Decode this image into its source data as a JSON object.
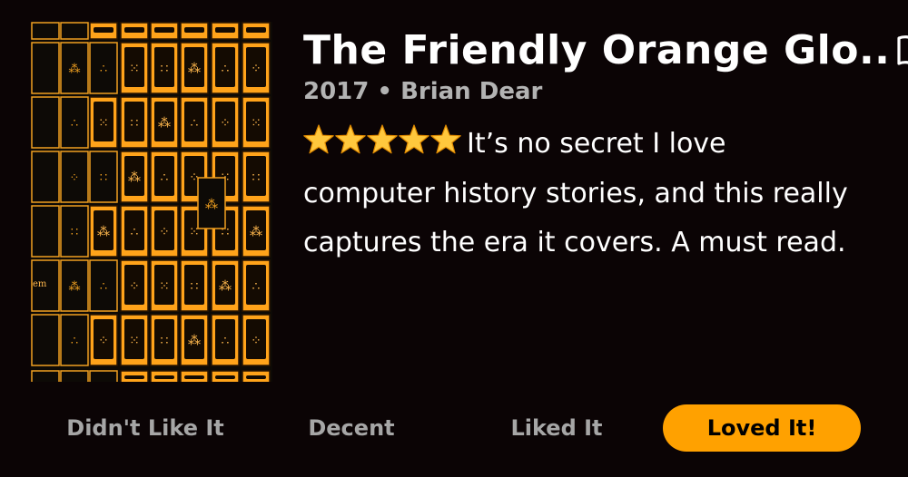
{
  "book": {
    "title": "The Friendly Orange Glo..",
    "title_icon": "book-open-icon",
    "meta": "2017 • Brian Dear",
    "cover_image": "mahjong-tiles-orange-cover",
    "cover_fragment_text": "em"
  },
  "review": {
    "rating_stars": 5,
    "rating_max": 5,
    "star_icon": "star-icon",
    "text": "It’s no secret I love computer history stories, and this really captures the era it covers. A must read."
  },
  "rating_options": [
    {
      "label": "Didn't Like It",
      "selected": false
    },
    {
      "label": "Decent",
      "selected": false
    },
    {
      "label": "Liked It",
      "selected": false
    },
    {
      "label": "Loved It!",
      "selected": true
    }
  ],
  "colors": {
    "background": "#0b0405",
    "accent": "#ffa100",
    "muted_text": "#a6a6a6",
    "star": "#ffc83d"
  }
}
